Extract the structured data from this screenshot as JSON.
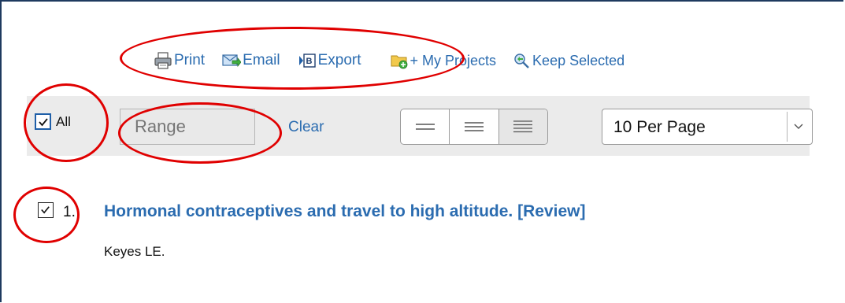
{
  "toolbar": {
    "print_label": "Print",
    "email_label": "Email",
    "export_label": "Export",
    "projects_label": "+ My Projects",
    "keep_label": "Keep Selected"
  },
  "filter_bar": {
    "all_label": "All",
    "all_checked": true,
    "range_placeholder": "Range",
    "clear_label": "Clear",
    "density_options": [
      "compact",
      "normal",
      "expanded"
    ],
    "density_selected": "expanded",
    "per_page_value": "10 Per Page"
  },
  "results": [
    {
      "number": "1.",
      "title": "Hormonal contraceptives and travel to high altitude. [Review]",
      "author": "Keyes LE.",
      "checked": true
    }
  ],
  "colors": {
    "link": "#2b6cb0",
    "annotation": "#e00000",
    "bar_background": "#ebebeb"
  }
}
